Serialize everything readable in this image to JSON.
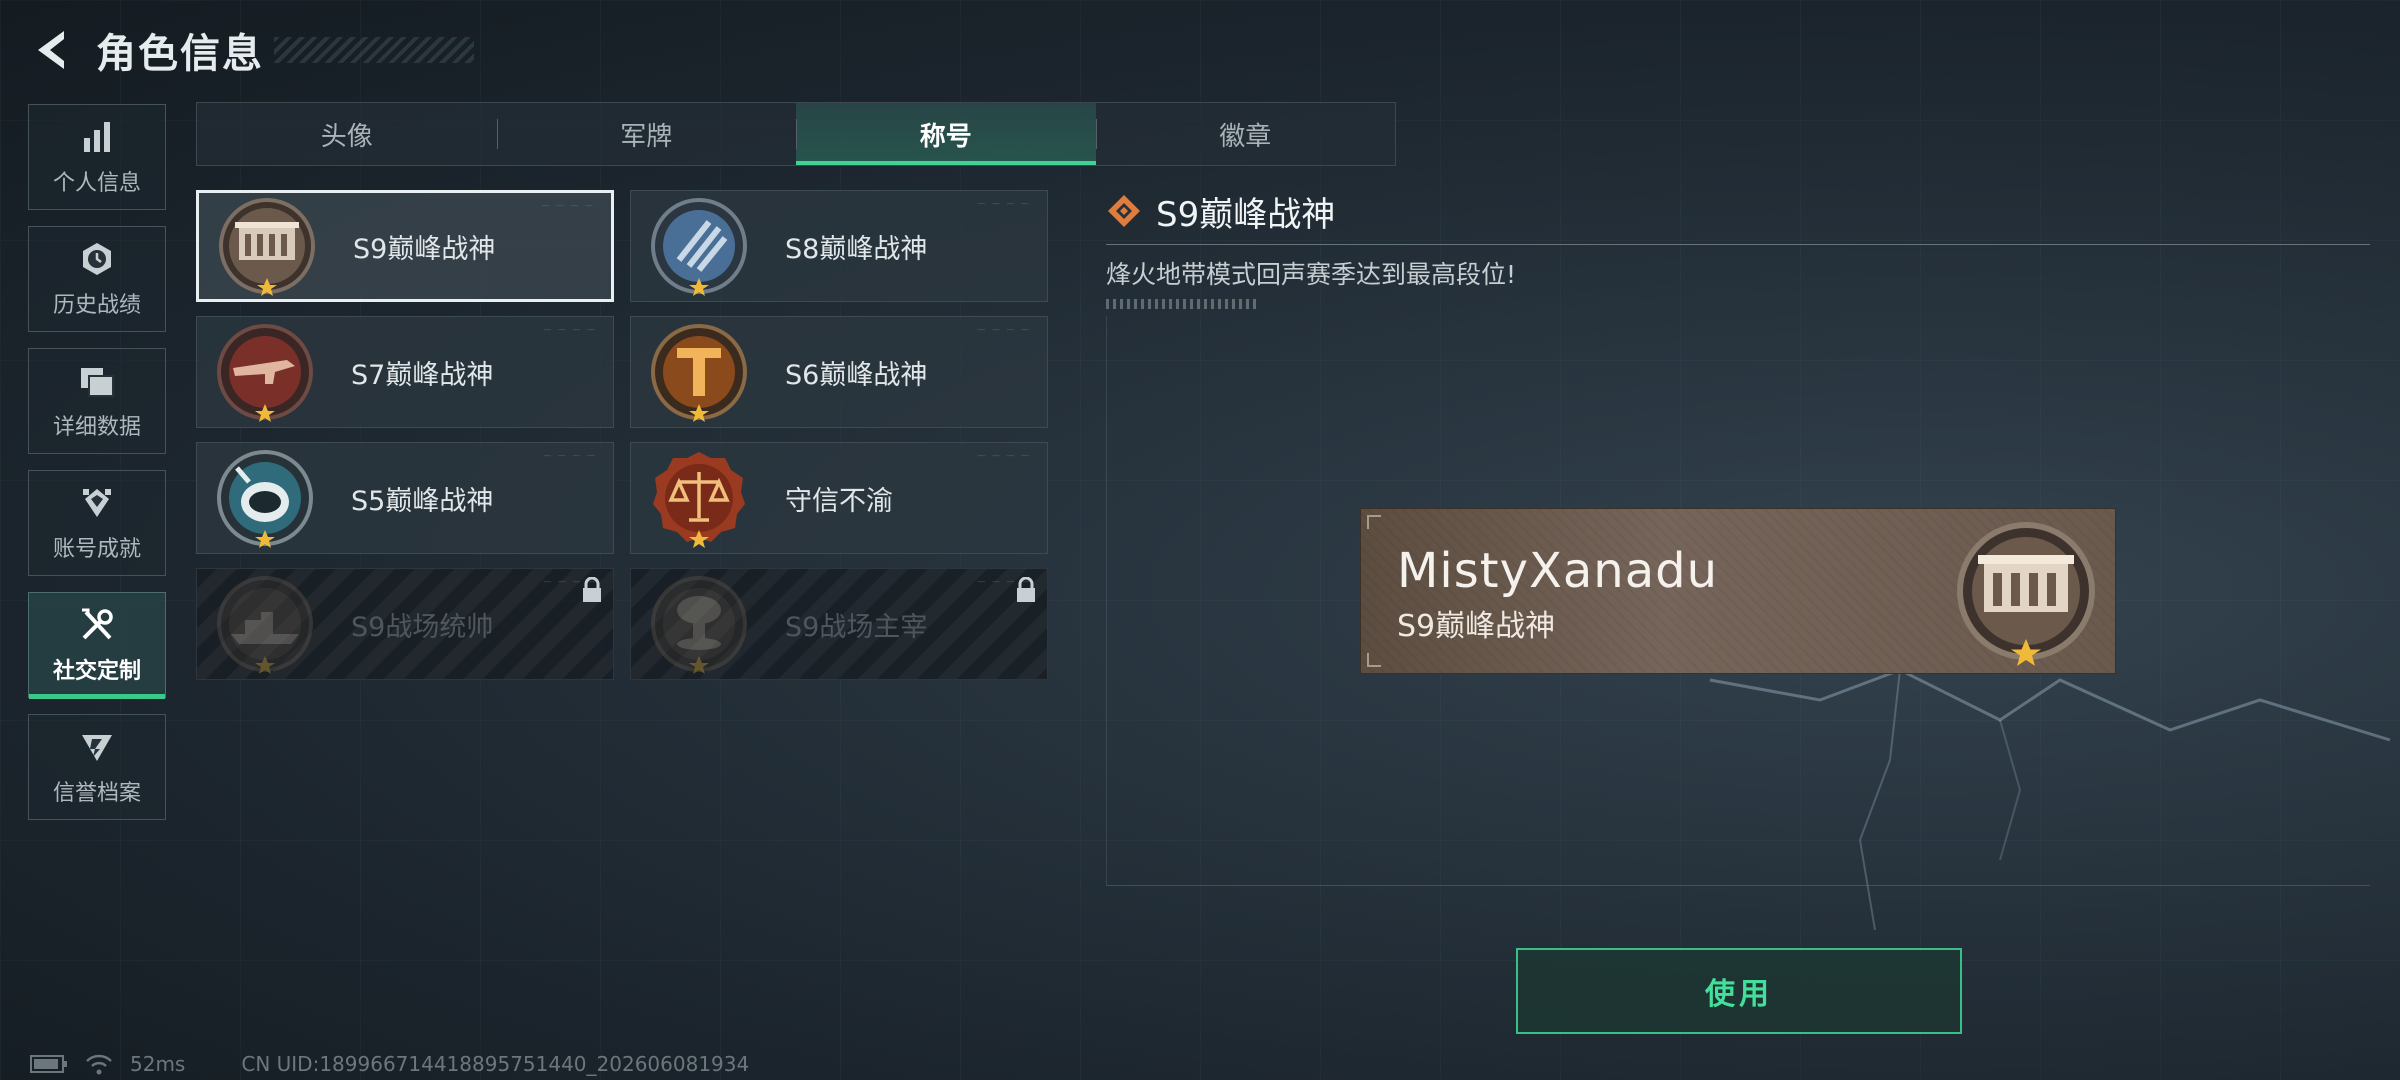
{
  "header": {
    "title": "角色信息"
  },
  "sidebar": {
    "items": [
      {
        "label": "个人信息",
        "icon": "bar-chart-icon",
        "active": false
      },
      {
        "label": "历史战绩",
        "icon": "clock-badge-icon",
        "active": false
      },
      {
        "label": "详细数据",
        "icon": "folder-stack-icon",
        "active": false
      },
      {
        "label": "账号成就",
        "icon": "achievement-icon",
        "active": false
      },
      {
        "label": "社交定制",
        "icon": "wrench-screwdriver-icon",
        "active": true
      },
      {
        "label": "信誉档案",
        "icon": "reputation-shield-icon",
        "active": false
      }
    ]
  },
  "tabs": [
    {
      "label": "头像",
      "active": false
    },
    {
      "label": "军牌",
      "active": false
    },
    {
      "label": "称号",
      "active": true
    },
    {
      "label": "徽章",
      "active": false
    }
  ],
  "titles": [
    {
      "label": "S9巅峰战神",
      "medal": "fortress-medal",
      "selected": true,
      "locked": false
    },
    {
      "label": "S8巅峰战神",
      "medal": "blue-slash-medal",
      "selected": false,
      "locked": false
    },
    {
      "label": "S7巅峰战神",
      "medal": "red-gun-medal",
      "selected": false,
      "locked": false
    },
    {
      "label": "S6巅峰战神",
      "medal": "orange-t-medal",
      "selected": false,
      "locked": false
    },
    {
      "label": "S5巅峰战神",
      "medal": "diver-helmet-medal",
      "selected": false,
      "locked": false
    },
    {
      "label": "守信不渝",
      "medal": "scales-medal",
      "selected": false,
      "locked": false
    },
    {
      "label": "S9战场统帅",
      "medal": "warship-medal",
      "selected": false,
      "locked": true
    },
    {
      "label": "S9战场主宰",
      "medal": "mushroom-cloud-medal",
      "selected": false,
      "locked": true
    }
  ],
  "detail": {
    "title": "S9巅峰战神",
    "description": "烽火地带模式回声赛季达到最高段位!"
  },
  "preview": {
    "player_name": "MistyXanadu",
    "title": "S9巅峰战神"
  },
  "use_button": {
    "label": "使用"
  },
  "footer": {
    "ping": "52ms",
    "uid": "CN UID:18996671441889575144​0_202606081934"
  },
  "colors": {
    "accent_green": "#3fd394",
    "button_text": "#43e09b",
    "orange_diamond": "#e07c3c",
    "star_gold": "#f0b93a"
  }
}
